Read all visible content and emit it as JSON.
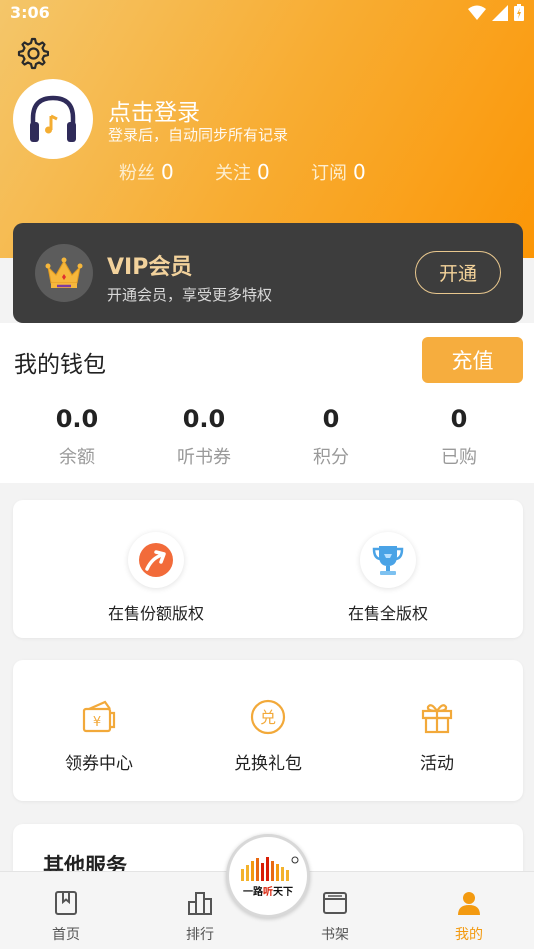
{
  "status_bar": {
    "time": "3:06"
  },
  "header": {
    "login_title": "点击登录",
    "login_subtitle": "登录后，自动同步所有记录",
    "stats": [
      {
        "label": "粉丝",
        "value": "0"
      },
      {
        "label": "关注",
        "value": "0"
      },
      {
        "label": "订阅",
        "value": "0"
      }
    ]
  },
  "vip": {
    "title": "VIP会员",
    "subtitle": "开通会员，享受更多特权",
    "button": "开通"
  },
  "wallet": {
    "title": "我的钱包",
    "recharge": "充值",
    "stats": [
      {
        "value": "0.0",
        "label": "余额"
      },
      {
        "value": "0.0",
        "label": "听书券"
      },
      {
        "value": "0",
        "label": "积分"
      },
      {
        "value": "0",
        "label": "已购"
      }
    ]
  },
  "features": [
    {
      "label": "在售份额版权",
      "icon": "arrow-up-circle-icon"
    },
    {
      "label": "在售全版权",
      "icon": "trophy-icon"
    }
  ],
  "tools": [
    {
      "label": "领券中心",
      "icon": "coupon-icon"
    },
    {
      "label": "兑换礼包",
      "icon": "exchange-icon"
    },
    {
      "label": "活动",
      "icon": "gift-icon"
    }
  ],
  "other_services": {
    "title": "其他服务"
  },
  "logo": {
    "text_1": "一路",
    "text_2": "听",
    "text_3": "天下"
  },
  "tabbar": [
    {
      "label": "首页",
      "icon": "book-icon"
    },
    {
      "label": "排行",
      "icon": "ranking-icon"
    },
    {
      "label": "书架",
      "icon": "bookshelf-icon"
    },
    {
      "label": "我的",
      "icon": "user-icon",
      "active": true
    }
  ],
  "colors": {
    "accent": "#f39a10",
    "vip_gold": "#f2d29c",
    "vip_bg": "#3d3d3d",
    "recharge": "#f6ad3e"
  }
}
